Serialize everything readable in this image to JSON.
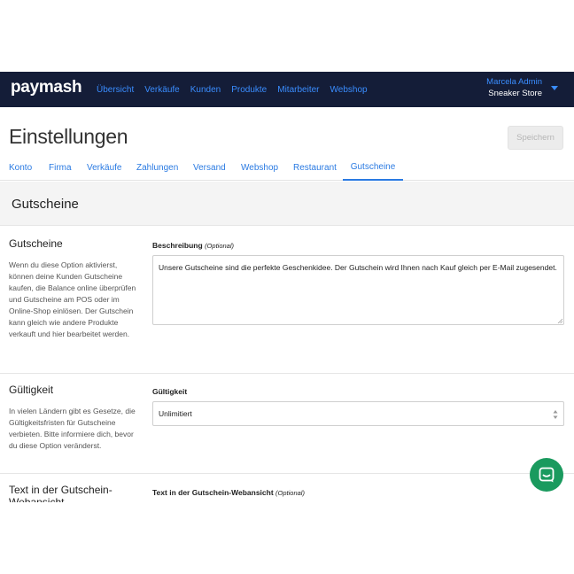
{
  "app": {
    "logo": "paymash"
  },
  "nav": {
    "items": [
      {
        "label": "Übersicht"
      },
      {
        "label": "Verkäufe"
      },
      {
        "label": "Kunden"
      },
      {
        "label": "Produkte"
      },
      {
        "label": "Mitarbeiter"
      },
      {
        "label": "Webshop"
      }
    ]
  },
  "user": {
    "name": "Marcela Admin",
    "store": "Sneaker Store"
  },
  "page": {
    "title": "Einstellungen",
    "save_label": "Speichern"
  },
  "tabs": [
    {
      "label": "Konto"
    },
    {
      "label": "Firma"
    },
    {
      "label": "Verkäufe"
    },
    {
      "label": "Zahlungen"
    },
    {
      "label": "Versand"
    },
    {
      "label": "Webshop"
    },
    {
      "label": "Restaurant"
    },
    {
      "label": "Gutscheine",
      "active": true
    }
  ],
  "section": {
    "title": "Gutscheine"
  },
  "blocks": {
    "gutscheine": {
      "title": "Gutscheine",
      "description": "Wenn du diese Option aktivierst, können deine Kunden Gutscheine kaufen, die Balance online überprüfen und Gutscheine am POS oder im Online-Shop einlösen. Der Gutschein kann gleich wie andere Produkte verkauft und hier bearbeitet werden.",
      "field_label": "Beschreibung",
      "field_optional": "(Optional)",
      "field_value": "Unsere Gutscheine sind die perfekte Geschenkidee. Der Gutschein wird Ihnen nach Kauf gleich per E-Mail zugesendet."
    },
    "gueltigkeit": {
      "title": "Gültigkeit",
      "description": "In vielen Ländern gibt es Gesetze, die Gültigkeitsfristen für Gutscheine verbieten. Bitte informiere dich, bevor du diese Option veränderst.",
      "field_label": "Gültigkeit",
      "select_value": "Unlimitiert"
    },
    "webansicht": {
      "title": "Text in der Gutschein-Webansicht",
      "field_label": "Text in der Gutschein-Webansicht",
      "field_optional": "(Optional)"
    }
  },
  "colors": {
    "nav_bg": "#141d38",
    "accent": "#2a7ae2",
    "chat": "#1a9a5e"
  },
  "icons": {
    "dropdown": "chevron-down-icon",
    "chat": "chat-icon",
    "select": "select-arrows-icon"
  }
}
